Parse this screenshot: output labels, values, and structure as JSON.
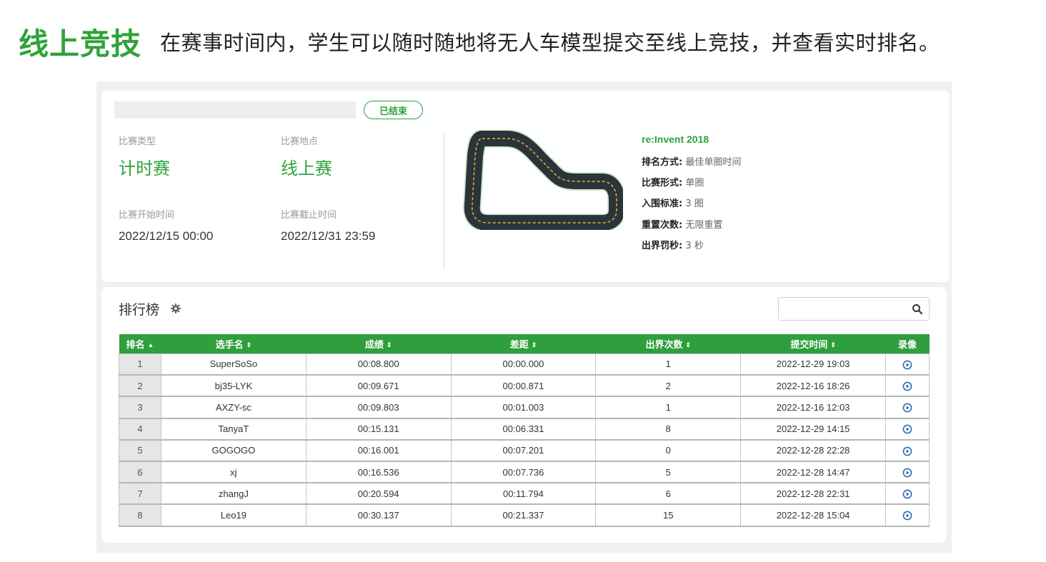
{
  "header": {
    "title": "线上竞技",
    "description": "在赛事时间内，学生可以随时随地将无人车模型提交至线上竞技，并查看实时排名。"
  },
  "race": {
    "status": "已结束",
    "type_label": "比赛类型",
    "type_value": "计时赛",
    "location_label": "比赛地点",
    "location_value": "线上赛",
    "start_label": "比赛开始时间",
    "start_value": "2022/12/15 00:00",
    "end_label": "比赛截止时间",
    "end_value": "2022/12/31 23:59",
    "track_name": "re:Invent 2018",
    "rules": [
      {
        "key": "排名方式:",
        "value": "最佳单圈时间"
      },
      {
        "key": "比赛形式:",
        "value": "单圈"
      },
      {
        "key": "入围标准:",
        "value": "3 圈"
      },
      {
        "key": "重置次数:",
        "value": "无限重置"
      },
      {
        "key": "出界罚秒:",
        "value": "3 秒"
      }
    ]
  },
  "leaderboard": {
    "title": "排行榜",
    "search_placeholder": "",
    "columns": [
      {
        "label": "排名",
        "sort": "▲"
      },
      {
        "label": "选手名",
        "sort": "⇕"
      },
      {
        "label": "成绩",
        "sort": "⇕"
      },
      {
        "label": "差距",
        "sort": "⇕"
      },
      {
        "label": "出界次数",
        "sort": "⇕"
      },
      {
        "label": "提交时间",
        "sort": "⇕"
      },
      {
        "label": "录像",
        "sort": ""
      }
    ],
    "rows": [
      {
        "rank": "1",
        "name": "SuperSoSo",
        "time": "00:08.800",
        "gap": "00:00.000",
        "off_track": "1",
        "submitted": "2022-12-29 19:03"
      },
      {
        "rank": "2",
        "name": "bj35-LYK",
        "time": "00:09.671",
        "gap": "00:00.871",
        "off_track": "2",
        "submitted": "2022-12-16 18:26"
      },
      {
        "rank": "3",
        "name": "AXZY-sc",
        "time": "00:09.803",
        "gap": "00:01.003",
        "off_track": "1",
        "submitted": "2022-12-16 12:03"
      },
      {
        "rank": "4",
        "name": "TanyaT",
        "time": "00:15.131",
        "gap": "00:06.331",
        "off_track": "8",
        "submitted": "2022-12-29 14:15"
      },
      {
        "rank": "5",
        "name": "GOGOGO",
        "time": "00:16.001",
        "gap": "00:07.201",
        "off_track": "0",
        "submitted": "2022-12-28 22:28"
      },
      {
        "rank": "6",
        "name": "xj",
        "time": "00:16.536",
        "gap": "00:07.736",
        "off_track": "5",
        "submitted": "2022-12-28 14:47"
      },
      {
        "rank": "7",
        "name": "zhangJ",
        "time": "00:20.594",
        "gap": "00:11.794",
        "off_track": "6",
        "submitted": "2022-12-28 22:31"
      },
      {
        "rank": "8",
        "name": "Leo19",
        "time": "00:30.137",
        "gap": "00:21.337",
        "off_track": "15",
        "submitted": "2022-12-28 15:04"
      }
    ]
  },
  "icons": {
    "settings": "gear-icon",
    "search": "search-icon",
    "replay": "play-circle-icon"
  },
  "colors": {
    "accent": "#2fa33a",
    "table_header": "#2f9e3c",
    "replay_icon": "#2b6fb0"
  }
}
